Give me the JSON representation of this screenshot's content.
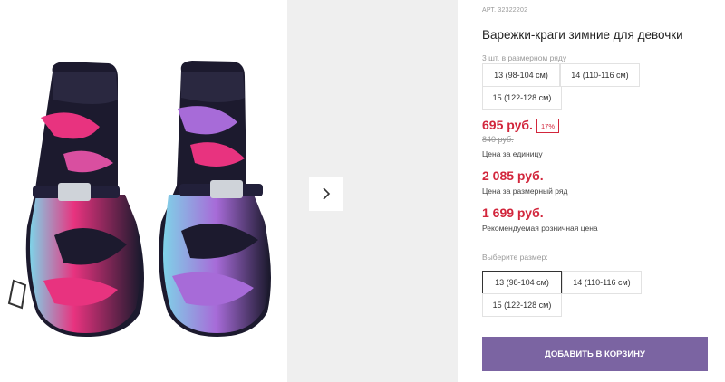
{
  "product": {
    "article": "АРТ. 32322202",
    "title": "Варежки-краги зимние для девочки",
    "pack_note": "3 шт. в размерном ряду",
    "pack_sizes": [
      "13 (98-104 см)",
      "14 (110-116 см)",
      "15 (122-128 см)"
    ],
    "price": "695 руб.",
    "discount": "17%",
    "old_price": "840 руб.",
    "price_caption": "Цена за единицу",
    "pack_price": "2 085 руб.",
    "pack_price_caption": "Цена за размерный ряд",
    "rrp": "1 699 руб.",
    "rrp_caption": "Рекомендуемая розничная цена",
    "select_label": "Выберите размер:",
    "size_options": [
      "13 (98-104 см)",
      "14 (110-116 см)",
      "15 (122-128 см)"
    ],
    "selected_size": "13 (98-104 см)",
    "add_to_cart": "Добавить в корзину"
  },
  "icons": {
    "next": "chevron-right-icon"
  },
  "colors": {
    "price": "#d2263c",
    "button": "#7b64a2",
    "mitten_base": "#1c1a2e",
    "accent_pink": "#e8337f",
    "accent_purple": "#a76bd8",
    "accent_cyan": "#7fd3e8"
  }
}
